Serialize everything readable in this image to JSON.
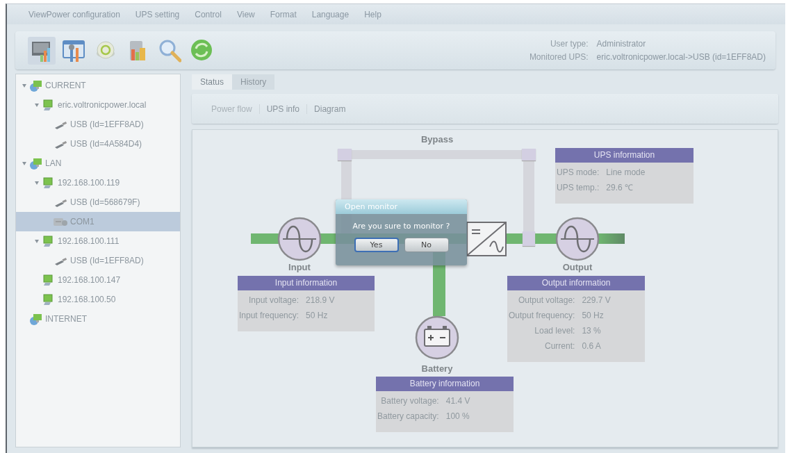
{
  "menu": [
    "ViewPower configuration",
    "UPS setting",
    "Control",
    "View",
    "Format",
    "Language",
    "Help"
  ],
  "toolbar": [
    {
      "kind": "monitor",
      "selected": true
    },
    {
      "kind": "tools",
      "selected": false
    },
    {
      "kind": "disc",
      "selected": false
    },
    {
      "kind": "chart",
      "selected": false
    },
    {
      "kind": "search",
      "selected": false
    },
    {
      "kind": "refresh",
      "selected": false
    }
  ],
  "header_info": [
    {
      "label": "User type:",
      "value": "Administrator"
    },
    {
      "label": "Monitored UPS:",
      "value": "eric.voltronicpower.local->USB (id=1EFF8AD)"
    }
  ],
  "tree": [
    {
      "label": "CURRENT",
      "kind": "network",
      "expanded": true,
      "selected": false,
      "children": [
        {
          "label": "eric.voltronicpower.local",
          "kind": "computer",
          "expanded": true,
          "selected": false,
          "children": [
            {
              "label": "USB (Id=1EFF8AD)",
              "kind": "usb",
              "selected": false
            },
            {
              "label": "USB (Id=4A584D4)",
              "kind": "usb",
              "selected": false
            }
          ]
        }
      ]
    },
    {
      "label": "LAN",
      "kind": "network",
      "expanded": true,
      "selected": false,
      "children": [
        {
          "label": "192.168.100.119",
          "kind": "computer",
          "expanded": true,
          "selected": false,
          "children": [
            {
              "label": "USB (Id=568679F)",
              "kind": "usb",
              "selected": false
            },
            {
              "label": "COM1",
              "kind": "com",
              "selected": true
            }
          ]
        },
        {
          "label": "192.168.100.111",
          "kind": "computer",
          "expanded": true,
          "selected": false,
          "children": [
            {
              "label": "USB (Id=1EFF8AD)",
              "kind": "usb",
              "selected": false
            }
          ]
        },
        {
          "label": "192.168.100.147",
          "kind": "computer",
          "selected": false
        },
        {
          "label": "192.168.100.50",
          "kind": "computer",
          "selected": false
        }
      ]
    },
    {
      "label": "INTERNET",
      "kind": "network",
      "selected": false
    }
  ],
  "tabs": [
    {
      "label": "Status",
      "selected": true
    },
    {
      "label": "History",
      "selected": false
    }
  ],
  "view_buttons": [
    {
      "label": "Power flow",
      "disabled": true
    },
    {
      "label": "UPS info",
      "disabled": false
    },
    {
      "label": "Diagram",
      "disabled": false
    }
  ],
  "diagram": {
    "bypass": {
      "label": "Bypass",
      "active": false
    },
    "ups_info": {
      "title": "UPS information",
      "rows": [
        {
          "label": "UPS mode:",
          "value": "Line mode"
        },
        {
          "label": "UPS temp.:",
          "value": "29.6 ℃"
        }
      ]
    },
    "input": {
      "label": "Input",
      "active": true,
      "info": {
        "title": "Input information",
        "rows": [
          {
            "label": "Input voltage:",
            "value": "218.9 V"
          },
          {
            "label": "Input frequency:",
            "value": "50 Hz"
          }
        ]
      }
    },
    "output": {
      "label": "Output",
      "active": true,
      "info": {
        "title": "Output information",
        "rows": [
          {
            "label": "Output voltage:",
            "value": "229.7 V"
          },
          {
            "label": "Output frequency:",
            "value": "50 Hz"
          },
          {
            "label": "Load level:",
            "value": "13 %"
          },
          {
            "label": "Current:",
            "value": "0.6 A"
          }
        ]
      }
    },
    "battery": {
      "label": "Battery",
      "active": true,
      "info": {
        "title": "Battery information",
        "rows": [
          {
            "label": "Battery voltage:",
            "value": "41.4 V"
          },
          {
            "label": "Battery capacity:",
            "value": "100 %"
          }
        ]
      }
    }
  },
  "dialog": {
    "title": "Open monitor",
    "message": "Are you sure to monitor ?",
    "buttons": [
      {
        "label": "Yes",
        "focused": true
      },
      {
        "label": "No",
        "focused": false
      }
    ]
  }
}
